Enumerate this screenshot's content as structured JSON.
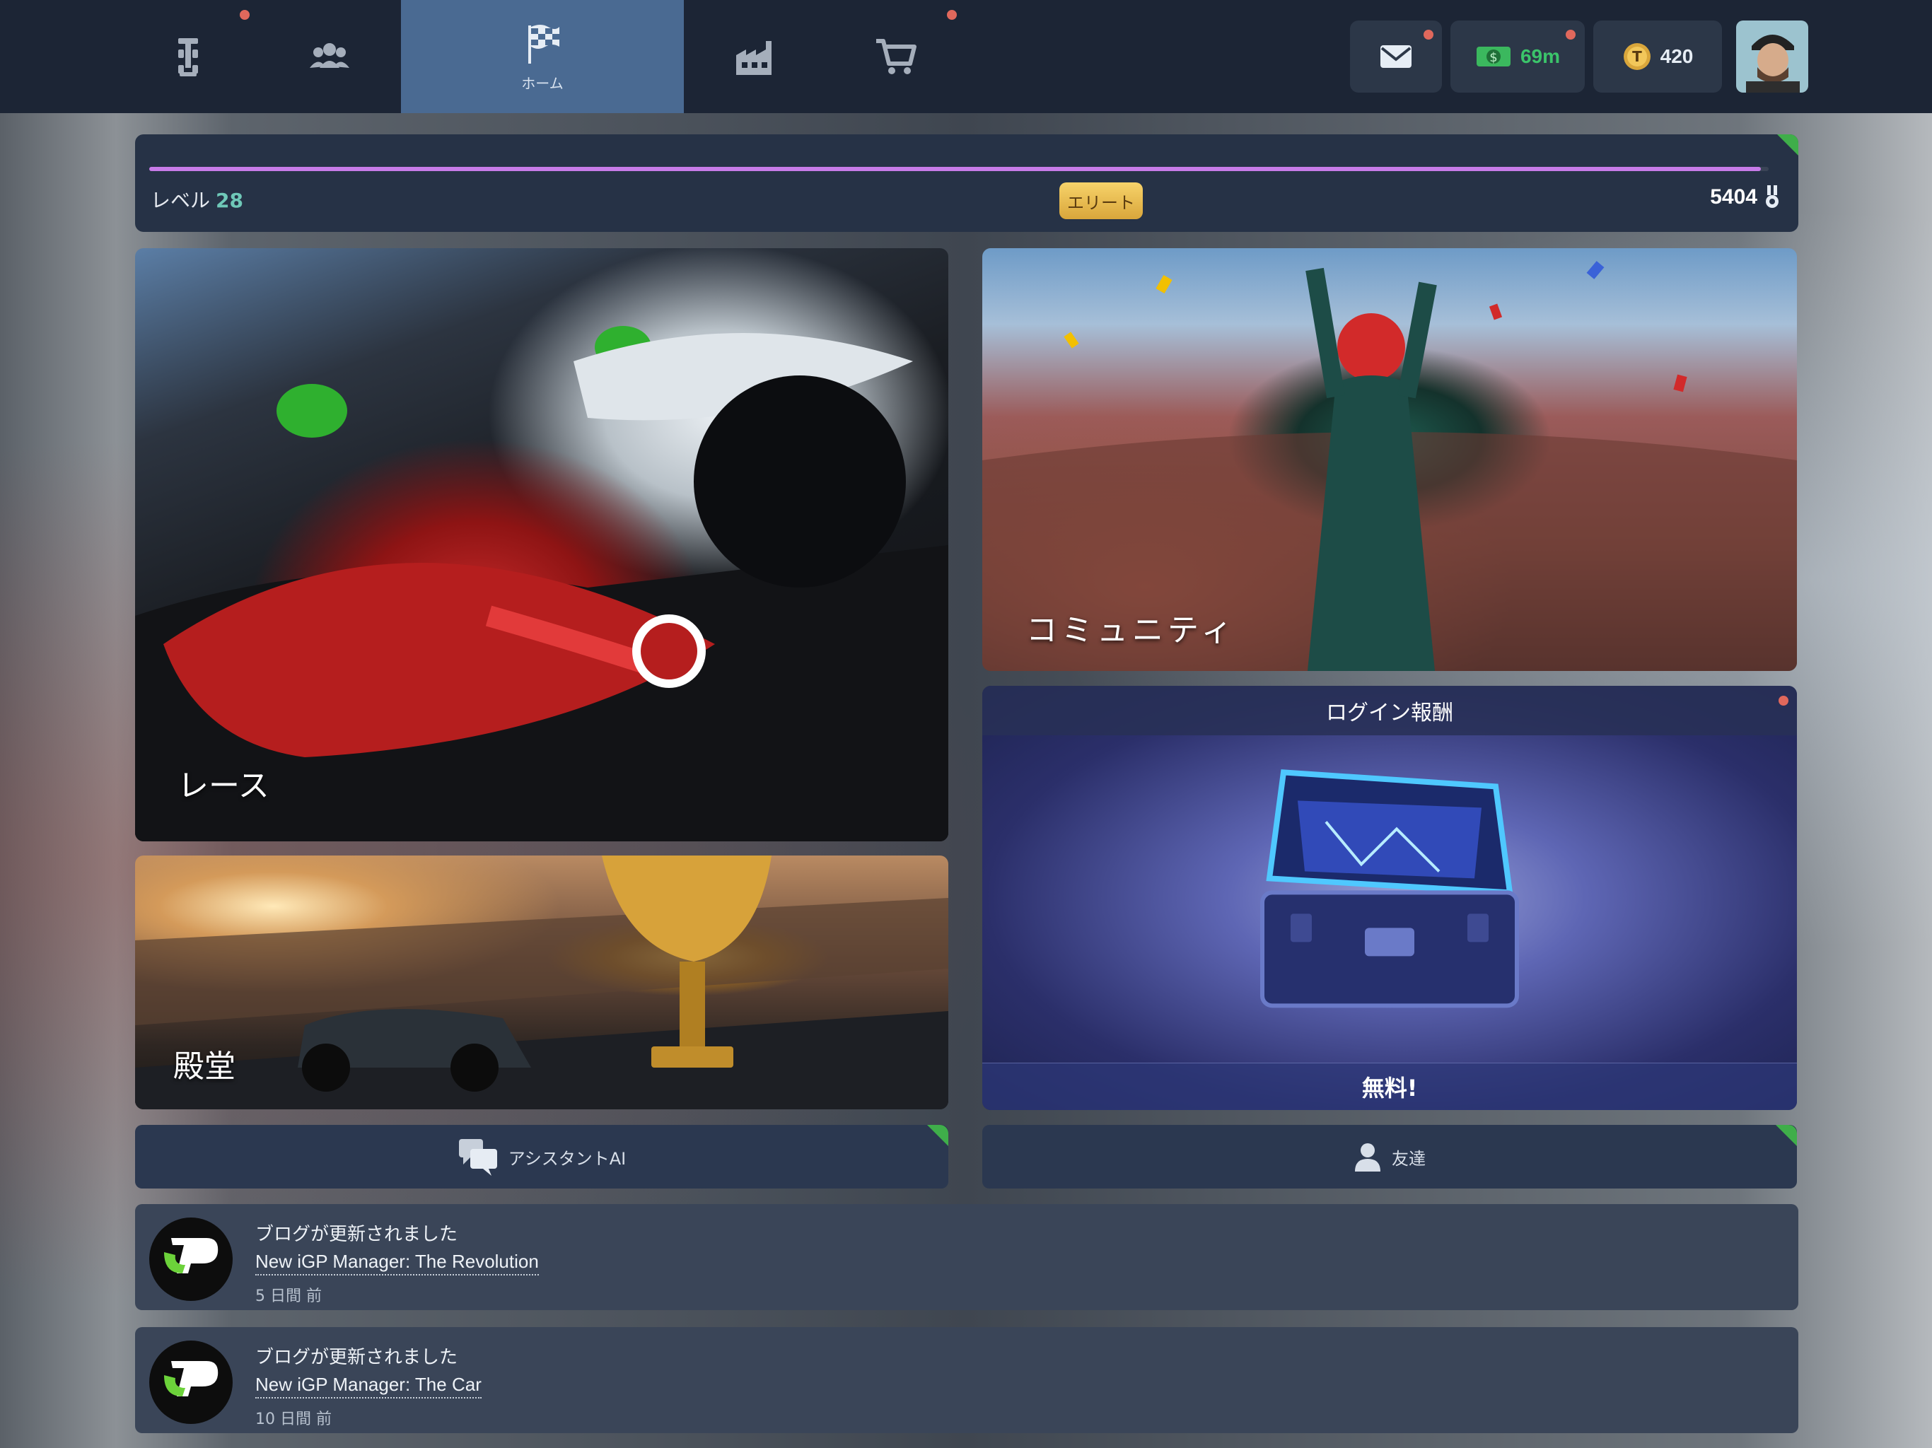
{
  "nav": {
    "home_label": "ホーム",
    "money": "69m",
    "tokens": "420"
  },
  "level": {
    "label": "レベル",
    "value": "28",
    "tier": "エリート",
    "points": "5404",
    "progress": 0.995
  },
  "cards": {
    "race": "レース",
    "community": "コミュニティ",
    "hall": "殿堂",
    "login_title": "ログイン報酬",
    "login_footer": "無料!"
  },
  "buttons": {
    "assistant": "アシスタントAI",
    "friends": "友達"
  },
  "blog": [
    {
      "heading": "ブログが更新されました",
      "title": "New iGP Manager: The Revolution",
      "time": "5 日間 前"
    },
    {
      "heading": "ブログが更新されました",
      "title": "New iGP Manager: The Car",
      "time": "10 日間 前"
    }
  ],
  "colors": {
    "topbar": "#1c2535",
    "active_tab": "#4a6a92",
    "progress": "#c77be8",
    "money_text": "#3bc46a",
    "notification_dot": "#e0685c"
  }
}
